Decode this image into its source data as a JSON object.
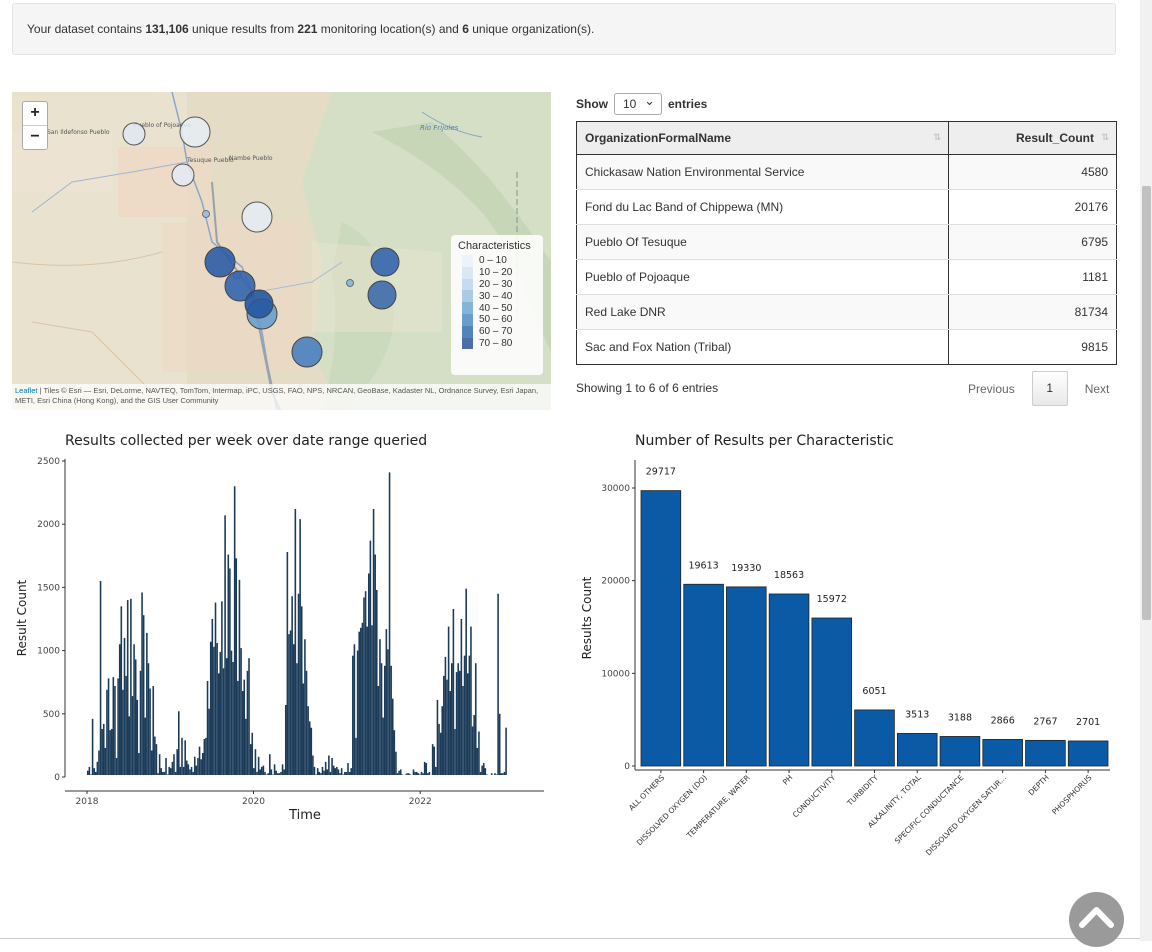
{
  "summary": {
    "prefix": "Your dataset contains ",
    "results": "131,106",
    "mid1": " unique results from ",
    "locations": "221",
    "mid2": " monitoring location(s) and ",
    "orgs": "6",
    "suffix": " unique organization(s)."
  },
  "map": {
    "zoom_in": "+",
    "zoom_out": "−",
    "place_labels": [
      "San Ildefonso Pueblo",
      "Pueblo of Pojoaque",
      "Nambe Pueblo",
      "Tesuque Pueblo",
      "Rio Frijoles"
    ],
    "legend": {
      "title": "Characteristics",
      "items": [
        {
          "label": "0 – 10",
          "color": "#eef3f9"
        },
        {
          "label": "10 – 20",
          "color": "#dbe7f3"
        },
        {
          "label": "20 – 30",
          "color": "#c6dbef"
        },
        {
          "label": "30 – 40",
          "color": "#a9cbe4"
        },
        {
          "label": "40 – 50",
          "color": "#86b3d8"
        },
        {
          "label": "50 – 60",
          "color": "#6a9dcb"
        },
        {
          "label": "60 – 70",
          "color": "#5483bb"
        },
        {
          "label": "70 – 80",
          "color": "#4c6fa7"
        }
      ]
    },
    "attribution_link": "Leaflet",
    "attribution_text": " | Tiles © Esri — Esri, DeLorme, NAVTEQ, TomTom, Intermap, iPC, USGS, FAO, NPS, NRCAN, GeoBase, Kadaster NL, Ordnance Survey, Esri Japan, METI, Esri China (Hong Kong), and the GIS User Community"
  },
  "table": {
    "show_label": "Show",
    "entries_label": "entries",
    "page_size": "10",
    "columns": [
      "OrganizationFormalName",
      "Result_Count"
    ],
    "sort_icon": "⇅",
    "rows": [
      {
        "name": "Chickasaw Nation Environmental Service",
        "count": "4580"
      },
      {
        "name": "Fond du Lac Band of Chippewa (MN)",
        "count": "20176"
      },
      {
        "name": "Pueblo Of Tesuque",
        "count": "6795"
      },
      {
        "name": "Pueblo of Pojoaque",
        "count": "1181"
      },
      {
        "name": "Red Lake DNR",
        "count": "81734"
      },
      {
        "name": "Sac and Fox Nation (Tribal)",
        "count": "9815"
      }
    ],
    "info": "Showing 1 to 6 of 6 entries",
    "prev": "Previous",
    "page": "1",
    "next": "Next"
  },
  "chart_data": [
    {
      "type": "bar",
      "title": "Results collected per week over date range queried",
      "xlabel": "Time",
      "ylabel": "Result Count",
      "xlim": [
        "2018-01-01",
        "2023-04-01"
      ],
      "ylim": [
        0,
        2500
      ],
      "xticks": [
        "2018",
        "2020",
        "2022"
      ],
      "yticks": [
        0,
        500,
        1000,
        1500,
        2000,
        2500
      ],
      "bar_color": "#1b3b59",
      "grid": false,
      "weekly_values": [
        50,
        80,
        20,
        460,
        70,
        40,
        120,
        210,
        1550,
        380,
        420,
        230,
        690,
        780,
        370,
        380,
        790,
        720,
        150,
        780,
        1050,
        1350,
        690,
        1100,
        800,
        1400,
        480,
        1410,
        640,
        1050,
        930,
        610,
        190,
        840,
        1460,
        1280,
        470,
        1140,
        900,
        700,
        210,
        720,
        320,
        260,
        30,
        180,
        70,
        40,
        40,
        150,
        20,
        80,
        70,
        120,
        180,
        40,
        220,
        520,
        80,
        310,
        80,
        290,
        130,
        100,
        60,
        80,
        40,
        160,
        90,
        150,
        240,
        140,
        190,
        300,
        310,
        760,
        540,
        1070,
        1250,
        1030,
        1380,
        1060,
        820,
        990,
        1390,
        860,
        2070,
        940,
        1760,
        1650,
        1000,
        910,
        2300,
        1730,
        760,
        1560,
        1020,
        680,
        770,
        460,
        840,
        940,
        260,
        350,
        70,
        220,
        40,
        160,
        60,
        80,
        90,
        40,
        20,
        30,
        180,
        60,
        20,
        100,
        50,
        30,
        30,
        40,
        100,
        60,
        570,
        1780,
        1130,
        1160,
        1430,
        1050,
        2120,
        900,
        1450,
        2040,
        1350,
        740,
        1090,
        840,
        560,
        440,
        390,
        170,
        80,
        20,
        70,
        40,
        30,
        80,
        50,
        120,
        60,
        170,
        40,
        150,
        90,
        70,
        80,
        60,
        30,
        70,
        20,
        40,
        40,
        110,
        40,
        70,
        960,
        1050,
        310,
        1000,
        1150,
        1180,
        1220,
        1420,
        1470,
        1190,
        1610,
        1870,
        1200,
        2120,
        1760,
        1480,
        720,
        1090,
        900,
        470,
        880,
        1170,
        1010,
        2410,
        880,
        620,
        370,
        200,
        30,
        50,
        60,
        20,
        10,
        20,
        30,
        30,
        20,
        10,
        60,
        40,
        40,
        30,
        20,
        40,
        30,
        120,
        110,
        30,
        40,
        10,
        260,
        240,
        80,
        610,
        420,
        350,
        560,
        800,
        950,
        770,
        1190,
        680,
        900,
        1330,
        380,
        830,
        900,
        840,
        1250,
        720,
        960,
        1490,
        820,
        960,
        1190,
        400,
        490,
        900,
        230,
        360,
        40,
        90,
        110,
        70,
        20,
        10,
        10,
        30,
        10,
        30,
        20,
        1450,
        500,
        30,
        30,
        40,
        390
      ]
    },
    {
      "type": "bar",
      "title": "Number of Results per Characteristic",
      "xlabel": "",
      "ylabel": "Results Count",
      "ylim": [
        0,
        30000
      ],
      "yticks": [
        0,
        10000,
        20000,
        30000
      ],
      "bar_color": "#0a5aa5",
      "categories": [
        "ALL OTHERS",
        "DISSOLVED OXYGEN (DO)",
        "TEMPERATURE, WATER",
        "PH",
        "CONDUCTIVITY",
        "TURBIDITY",
        "ALKALINITY, TOTAL",
        "SPECIFIC CONDUCTANCE",
        "DISSOLVED OXYGEN SATUR...",
        "DEPTH",
        "PHOSPHORUS"
      ],
      "values": [
        29717,
        19613,
        19330,
        18563,
        15972,
        6051,
        3513,
        3188,
        2866,
        2767,
        2701
      ]
    }
  ]
}
